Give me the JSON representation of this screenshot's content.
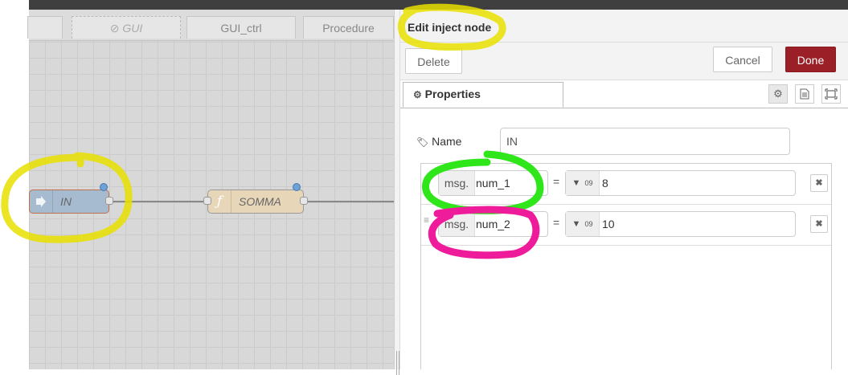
{
  "editor_tabs": [
    {
      "label": ""
    },
    {
      "label": "GUI",
      "icon": "disabled-icon"
    },
    {
      "label": "GUI_ctrl"
    },
    {
      "label": "Procedure"
    }
  ],
  "flow": {
    "inject_node": {
      "label": "IN",
      "icon": "inject-arrow-icon"
    },
    "function_node": {
      "label": "SOMMA",
      "icon": "function-icon"
    }
  },
  "tray": {
    "title": "Edit inject node",
    "delete_label": "Delete",
    "cancel_label": "Cancel",
    "done_label": "Done",
    "properties_tab_label": "Properties",
    "name_label": "Name",
    "name_value": "IN",
    "props": [
      {
        "prefix": "msg.",
        "property": "num_1",
        "equals": "=",
        "type_icon": "number-type-icon",
        "type_glyph": "09",
        "value": "8"
      },
      {
        "prefix": "msg.",
        "property": "num_2",
        "equals": "=",
        "type_icon": "number-type-icon",
        "type_glyph": "09",
        "value": "10"
      }
    ]
  },
  "colors": {
    "done_button": "#9a1f27",
    "inject_node": "#a6bbcf",
    "function_node": "#e7d6b8",
    "annotation_yellow": "#e8e000",
    "annotation_green": "#2ee61a",
    "annotation_magenta": "#ee1c9a"
  }
}
